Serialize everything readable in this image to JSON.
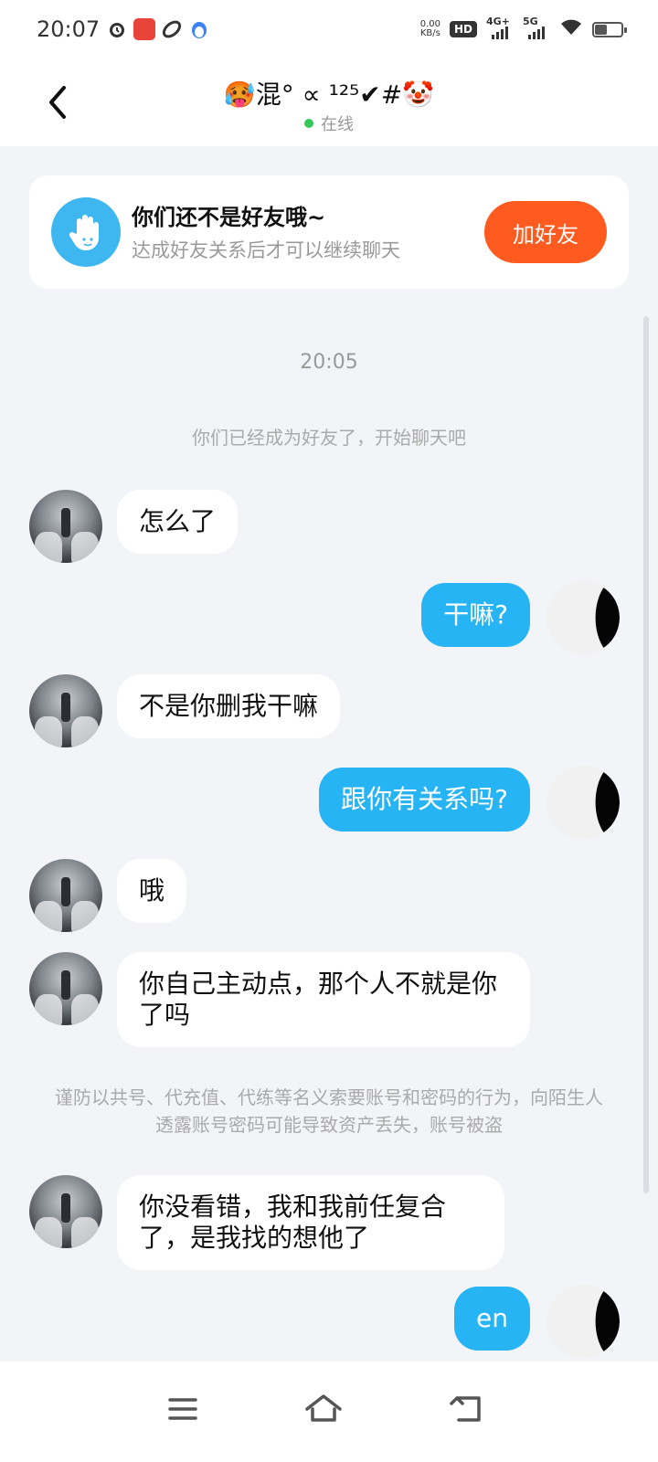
{
  "status_bar": {
    "time": "20:07",
    "net_speed_value": "0.00",
    "net_speed_unit": "KB/s",
    "hd_label": "HD",
    "signal1_label": "4G+",
    "signal2_label": "5G",
    "battery_level": 0.45
  },
  "header": {
    "contact_name": "🥵混° ∝ ¹²⁵✔#🤡",
    "online_status": "在线"
  },
  "friend_card": {
    "title": "你们还不是好友哦~",
    "subtitle": "达成好友关系后才可以继续聊天",
    "button_label": "加好友"
  },
  "chat": {
    "timestamp": "20:05",
    "system_friend_notice": "你们已经成为好友了，开始聊天吧",
    "security_notice": "谨防以共号、代充值、代练等名义索要账号和密码的行为，向陌生人透露账号密码可能导致资产丢失，账号被盗",
    "messages": [
      {
        "direction": "in",
        "text": "怎么了"
      },
      {
        "direction": "out",
        "text": "干嘛?"
      },
      {
        "direction": "in",
        "text": "不是你删我干嘛"
      },
      {
        "direction": "out",
        "text": "跟你有关系吗?"
      },
      {
        "direction": "in",
        "text": "哦"
      },
      {
        "direction": "in",
        "text": "你自己主动点，那个人不就是你了吗"
      },
      {
        "direction": "in",
        "text": "你没看错，我和我前任复合了，是我找的想他了"
      },
      {
        "direction": "out",
        "text": "en"
      }
    ]
  },
  "nav_bar": {
    "icons": [
      "menu-icon",
      "home-icon",
      "back-nav-icon"
    ]
  }
}
